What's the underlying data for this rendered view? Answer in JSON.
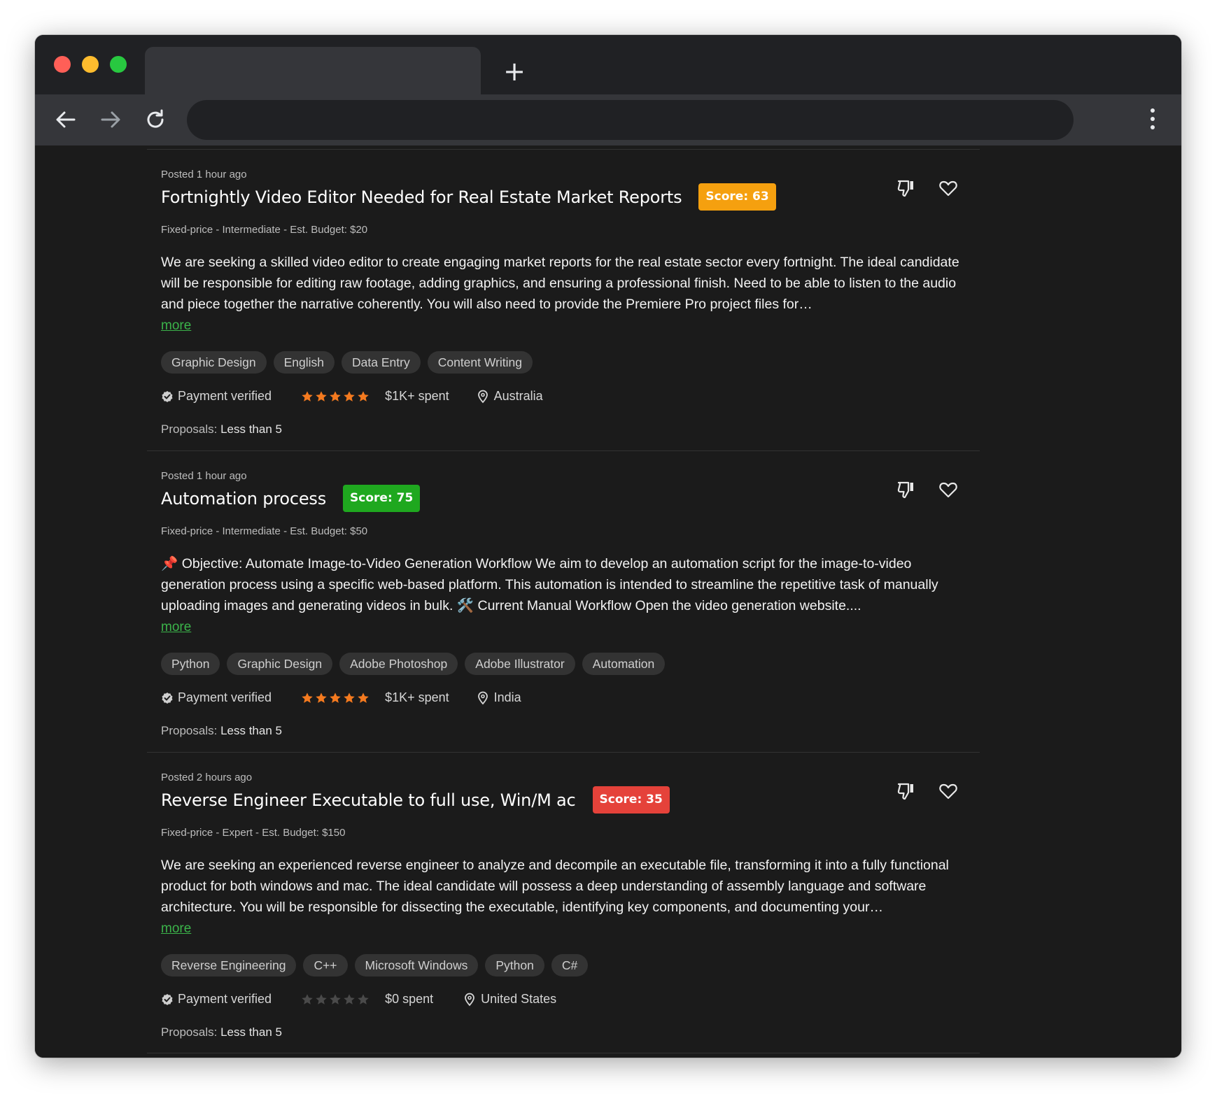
{
  "browser": {
    "new_tab_symbol": "+"
  },
  "jobs": [
    {
      "posted": "Posted 1 hour ago",
      "title": "Fortnightly Video Editor Needed for Real Estate Market Reports",
      "score": "Score: 63",
      "score_color": "#f5a00f",
      "meta": "Fixed-price - Intermediate - Est. Budget: $20",
      "description": "We are seeking a skilled video editor to create engaging market reports for the real estate sector every fortnight. The ideal candidate will be responsible for editing raw footage, adding graphics, and ensuring a professional finish. Need to be able to listen to the audio and piece together the narrative coherently. You will also need to provide the Premiere Pro project files for…",
      "more": "more",
      "tags": [
        "Graphic Design",
        "English",
        "Data Entry",
        "Content Writing"
      ],
      "payment": "Payment verified",
      "rating": 5,
      "spent": "$1K+ spent",
      "location": "Australia",
      "proposals_label": "Proposals:",
      "proposals_value": "Less than 5"
    },
    {
      "posted": "Posted 1 hour ago",
      "title": "Automation process",
      "score": "Score: 75",
      "score_color": "#1fa81f",
      "meta": "Fixed-price - Intermediate - Est. Budget: $50",
      "description": "📌 Objective: Automate Image-to-Video Generation Workflow We aim to develop an automation script for the image-to-video generation process using a specific web-based platform. This automation is intended to streamline the repetitive task of manually uploading images and generating videos in bulk. 🛠️ Current Manual Workflow Open the video generation website....",
      "more": "more",
      "tags": [
        "Python",
        "Graphic Design",
        "Adobe Photoshop",
        "Adobe Illustrator",
        "Automation"
      ],
      "payment": "Payment verified",
      "rating": 5,
      "spent": "$1K+ spent",
      "location": "India",
      "proposals_label": "Proposals:",
      "proposals_value": "Less than 5"
    },
    {
      "posted": "Posted 2 hours ago",
      "title": "Reverse Engineer Executable to full use, Win/M ac",
      "score": "Score: 35",
      "score_color": "#e5423a",
      "meta": "Fixed-price - Expert - Est. Budget: $150",
      "description": "We are seeking an experienced reverse engineer to analyze and decompile an executable file, transforming it into a fully functional product for both windows and mac. The ideal candidate will possess a deep understanding of assembly language and software architecture. You will be responsible for dissecting the executable, identifying key components, and documenting your…",
      "more": "more",
      "tags": [
        "Reverse Engineering",
        "C++",
        "Microsoft Windows",
        "Python",
        "C#"
      ],
      "payment": "Payment verified",
      "rating": 0,
      "spent": "$0 spent",
      "location": "United States",
      "proposals_label": "Proposals:",
      "proposals_value": "Less than 5"
    }
  ],
  "colors": {
    "star_filled": "#f47a1f",
    "star_empty": "#4a4a4a",
    "link": "#3bb34a"
  },
  "icons": [
    "back-arrow-icon",
    "forward-arrow-icon",
    "reload-icon",
    "more-vert-icon",
    "thumbs-down-icon",
    "heart-icon",
    "verified-check-icon",
    "star-icon",
    "location-pin-icon"
  ]
}
